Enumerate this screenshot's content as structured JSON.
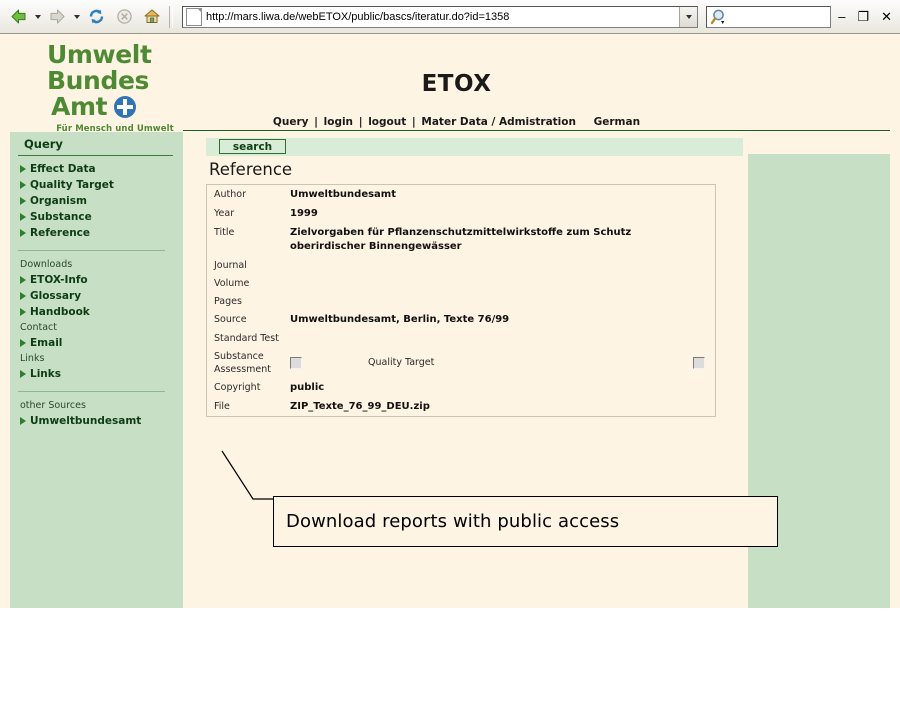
{
  "browser": {
    "back_icon": "back-arrow-icon",
    "forward_icon": "forward-arrow-icon",
    "refresh_icon": "refresh-icon",
    "stop_icon": "stop-icon",
    "home_icon": "home-icon",
    "page_icon": "page-icon",
    "url": "http://mars.liwa.de/webETOX/public/bascs/iteratur.do?id=1358",
    "url_dropdown_icon": "chevron-down-icon",
    "search_icon": "search-magnifier-icon",
    "search_value": "",
    "search_placeholder": "",
    "minimize_label": "–",
    "restore_label": "❐",
    "close_label": "✕"
  },
  "logo": {
    "line1": "Umwelt",
    "line2": "Bundes",
    "line3": "Amt",
    "emblem": "uba-emblem-icon",
    "tagline": "Für Mensch und Umwelt"
  },
  "header": {
    "title": "ETOX",
    "nav": [
      {
        "label": "Query"
      },
      {
        "label": "login"
      },
      {
        "label": "logout"
      },
      {
        "label": "Mater Data / Admistration"
      }
    ],
    "separator": "|",
    "language": "German"
  },
  "sidebar": {
    "section_title": "Query",
    "query_items": [
      {
        "label": "Effect Data"
      },
      {
        "label": "Quality Target"
      },
      {
        "label": "Organism"
      },
      {
        "label": "Substance"
      },
      {
        "label": "Reference"
      }
    ],
    "groups": [
      {
        "heading": "Downloads",
        "items": [
          {
            "label": "ETOX-Info"
          },
          {
            "label": "Glossary"
          },
          {
            "label": "Handbook"
          }
        ]
      },
      {
        "heading": "Contact",
        "items": [
          {
            "label": "Email"
          }
        ]
      },
      {
        "heading": "Links",
        "items": [
          {
            "label": "Links"
          }
        ]
      }
    ],
    "other_heading": "other Sources",
    "other_items": [
      {
        "label": "Umweltbundesamt"
      }
    ]
  },
  "main": {
    "search_button": "search",
    "section_title": "Reference",
    "fields": [
      {
        "label": "Author",
        "value": "Umweltbundesamt",
        "type": "text"
      },
      {
        "label": "Year",
        "value": "1999",
        "type": "text"
      },
      {
        "label": "Title",
        "value": "Zielvorgaben für Pflanzenschutzmittelwirkstoffe zum Schutz oberirdischer Binnengewässer",
        "type": "text"
      },
      {
        "label": "Journal",
        "value": "",
        "type": "text"
      },
      {
        "label": "Volume",
        "value": "",
        "type": "text"
      },
      {
        "label": "Pages",
        "value": "",
        "type": "text"
      },
      {
        "label": "Source",
        "value": "Umweltbundesamt, Berlin, Texte 76/99",
        "type": "text"
      },
      {
        "label": "Standard Test",
        "value": "",
        "type": "text"
      },
      {
        "label": "Substance Assessment",
        "value": "",
        "type": "checkboxes",
        "checkbox_left_checked": false,
        "inline_label": "Quality Target",
        "checkbox_right_checked": false
      },
      {
        "label": "Copyright",
        "value": "public",
        "type": "text"
      },
      {
        "label": "File",
        "value": "ZIP_Texte_76_99_DEU.zip",
        "type": "text"
      }
    ]
  },
  "annotation": {
    "text": "Download reports with public access",
    "leader_line": "callout-leader-line"
  },
  "colors": {
    "page_bg": "#fdf4e3",
    "sidebar_green": "#c7dfc5",
    "toolbar_green": "#d9ecd7",
    "logo_green": "#4e8a33",
    "rule_green": "#1b5e20",
    "emblem_blue": "#2f74b5"
  }
}
